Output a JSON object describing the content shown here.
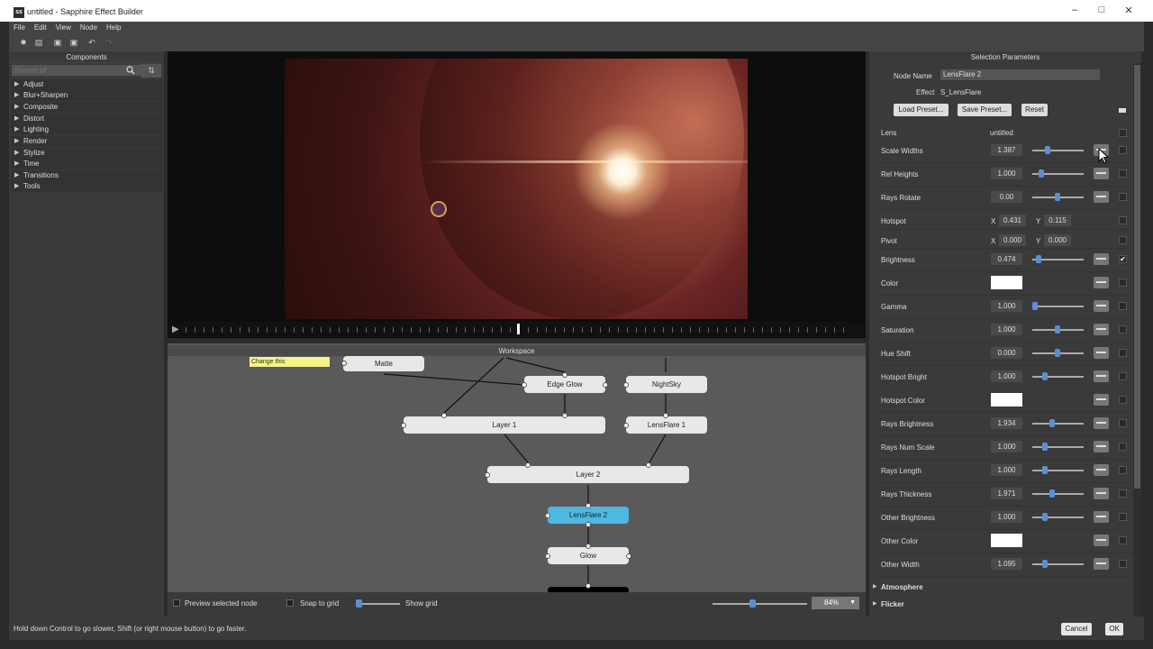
{
  "window": {
    "title": "untitled - Sapphire Effect Builder",
    "app_icon_text": "ss"
  },
  "menu": [
    "File",
    "Edit",
    "View",
    "Node",
    "Help"
  ],
  "left": {
    "header": "Components",
    "search_placeholder": "Search all",
    "categories": [
      "Adjust",
      "Blur+Sharpen",
      "Composite",
      "Distort",
      "Lighting",
      "Render",
      "Stylize",
      "Time",
      "Transitions",
      "Tools"
    ]
  },
  "workspace": {
    "header": "Workspace",
    "note": "Change this",
    "nodes": {
      "matte": "Matte",
      "edge_glow": "Edge Glow",
      "nightsky": "NightSky",
      "layer1": "Layer 1",
      "lensflare1": "LensFlare 1",
      "layer2": "Layer 2",
      "lensflare2": "LensFlare 2",
      "glow": "Glow"
    },
    "preview_label": "Preview selected node",
    "snap_label": "Snap to grid",
    "grid_label": "Show grid",
    "zoom": "84%"
  },
  "right": {
    "header": "Selection Parameters",
    "node_name_label": "Node Name",
    "node_name_value": "LensFlare 2",
    "effect_label": "Effect",
    "effect_value": "S_LensFlare",
    "load_preset": "Load Preset...",
    "save_preset": "Save Preset...",
    "reset": "Reset",
    "lens_label": "Lens",
    "lens_value": "untitled",
    "params": [
      {
        "label": "Scale Widths",
        "value": "1.387"
      },
      {
        "label": "Rel Heights",
        "value": "1.000"
      },
      {
        "label": "Rays Rotate",
        "value": "0.00"
      },
      {
        "label": "Hotspot",
        "x": "0.431",
        "y": "0.115"
      },
      {
        "label": "Pivot",
        "x": "0.000",
        "y": "0.000"
      },
      {
        "label": "Brightness",
        "value": "0.474"
      },
      {
        "label": "Color"
      },
      {
        "label": "Gamma",
        "value": "1.000"
      },
      {
        "label": "Saturation",
        "value": "1.000"
      },
      {
        "label": "Hue Shift",
        "value": "0.000"
      },
      {
        "label": "Hotspot Bright",
        "value": "1.000"
      },
      {
        "label": "Hotspot Color"
      },
      {
        "label": "Rays Brightness",
        "value": "1.934"
      },
      {
        "label": "Rays Num Scale",
        "value": "1.000"
      },
      {
        "label": "Rays Length",
        "value": "1.000"
      },
      {
        "label": "Rays Thickness",
        "value": "1.971"
      },
      {
        "label": "Other Brightness",
        "value": "1.000"
      },
      {
        "label": "Other Color"
      },
      {
        "label": "Other Width",
        "value": "1.095"
      }
    ],
    "sections": [
      "Atmosphere",
      "Flicker"
    ],
    "x_label": "X",
    "y_label": "Y",
    "checkmark": "✔"
  },
  "status": "Hold down Control to go slower, Shift (or right mouse button) to go faster.",
  "buttons": {
    "cancel": "Cancel",
    "ok": "OK"
  }
}
